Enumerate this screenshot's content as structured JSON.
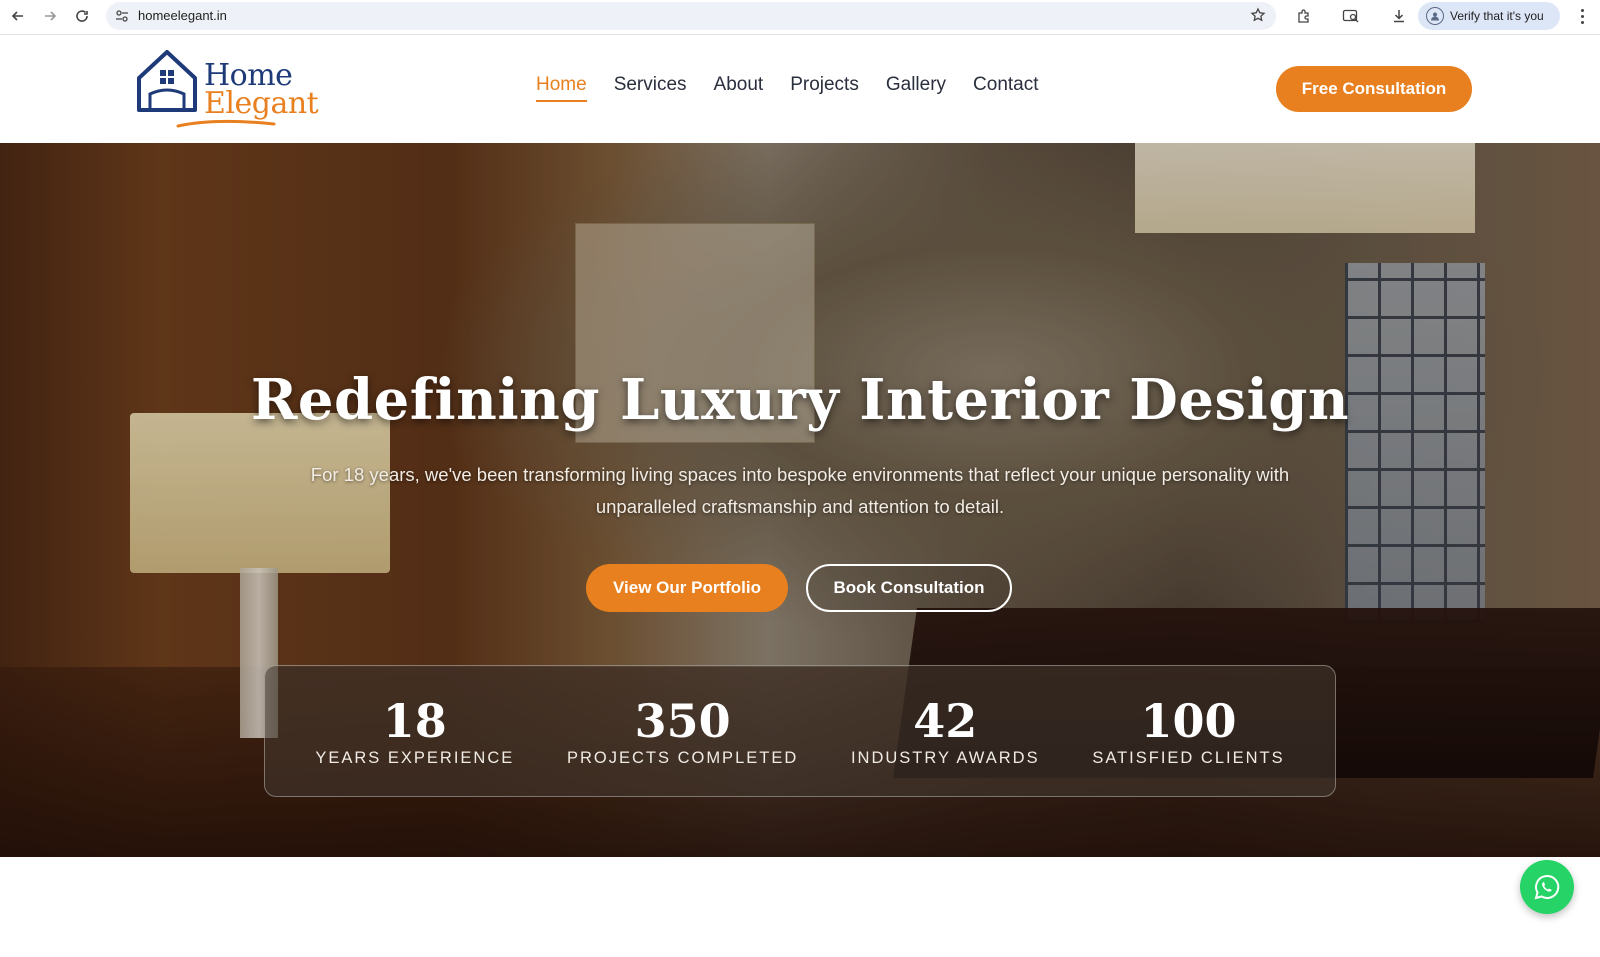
{
  "browser": {
    "url": "homeelegant.in",
    "verify_label": "Verify that it's you"
  },
  "logo": {
    "line1": "Home",
    "line2": "Elegant"
  },
  "nav": {
    "items": [
      {
        "label": "Home",
        "active": true
      },
      {
        "label": "Services",
        "active": false
      },
      {
        "label": "About",
        "active": false
      },
      {
        "label": "Projects",
        "active": false
      },
      {
        "label": "Gallery",
        "active": false
      },
      {
        "label": "Contact",
        "active": false
      }
    ],
    "cta_label": "Free Consultation"
  },
  "hero": {
    "title": "Redefining Luxury Interior Design",
    "subtitle": "For 18 years, we've been transforming living spaces into bespoke environments that reflect your unique personality with unparalleled craftsmanship and attention to detail.",
    "primary_button": "View Our Portfolio",
    "secondary_button": "Book Consultation"
  },
  "stats": [
    {
      "value": "18",
      "label": "YEARS EXPERIENCE"
    },
    {
      "value": "350",
      "label": "PROJECTS COMPLETED"
    },
    {
      "value": "42",
      "label": "INDUSTRY AWARDS"
    },
    {
      "value": "100",
      "label": "SATISFIED CLIENTS"
    }
  ],
  "colors": {
    "accent": "#e8801f",
    "brand_navy": "#1e3a78",
    "whatsapp": "#25d366"
  },
  "icons": {
    "back": "arrow-left-icon",
    "forward": "arrow-right-icon",
    "reload": "reload-icon",
    "site_settings": "tune-icon",
    "bookmark": "star-icon",
    "extensions": "puzzle-icon",
    "tab_search": "tab-search-icon",
    "download": "download-icon",
    "menu": "kebab-icon",
    "chat": "whatsapp-icon"
  }
}
